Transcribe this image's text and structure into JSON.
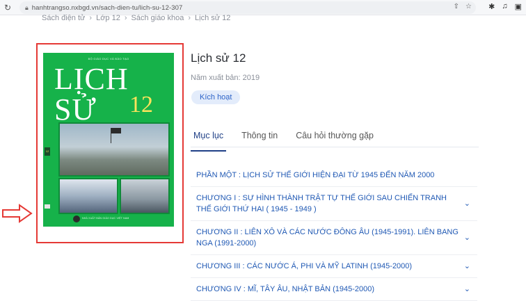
{
  "browser": {
    "url": "hanhtrangso.nxbgd.vn/sach-dien-tu/lich-su-12-307"
  },
  "breadcrumb": {
    "items": [
      "Sách điện tử",
      "Lớp 12",
      "Sách giáo khoa",
      "Lịch sử 12"
    ],
    "separator": "›"
  },
  "book": {
    "title": "Lịch sử 12",
    "year_label": "Năm xuất bản: 2019",
    "activate_label": "Kích hoạt",
    "cover": {
      "ministry": "BỘ GIÁO DỤC VÀ ĐÀO TẠO",
      "title": "LỊCH SỬ",
      "number": "12",
      "spine_number": "12",
      "publisher": "NHÀ XUẤT BẢN GIÁO DỤC VIỆT NAM"
    }
  },
  "tabs": [
    {
      "label": "Mục lục",
      "active": true
    },
    {
      "label": "Thông tin",
      "active": false
    },
    {
      "label": "Câu hỏi thường gặp",
      "active": false
    }
  ],
  "toc": [
    {
      "label": "PHẦN MỘT :  LỊCH SỬ THẾ GIỚI HIỆN ĐẠI TỪ 1945 ĐẾN NĂM 2000",
      "expandable": false
    },
    {
      "label": "CHƯƠNG I :  SỰ HÌNH THÀNH TRẬT TỰ THẾ GIỚI SAU CHIẾN TRANH THẾ GIỚI THỨ HAI ( 1945 - 1949 )",
      "expandable": true
    },
    {
      "label": "CHƯƠNG II :  LIÊN XÔ VÀ CÁC NƯỚC ĐÔNG ÂU (1945-1991). LIÊN BANG NGA (1991-2000)",
      "expandable": true
    },
    {
      "label": "CHƯƠNG III :  CÁC NƯỚC Á, PHI VÀ MỸ LATINH (1945-2000)",
      "expandable": true
    },
    {
      "label": "CHƯƠNG IV :  MĨ, TÂY ÂU, NHẬT BẢN (1945-2000)",
      "expandable": true
    }
  ],
  "colors": {
    "accent": "#2059b4",
    "tab_active": "#1f3f86",
    "highlight_frame": "#e53935",
    "cover_green": "#16b24a"
  }
}
